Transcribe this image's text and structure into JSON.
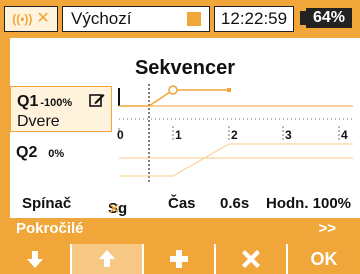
{
  "status": {
    "model": "Výchozí",
    "time": "12:22:59",
    "battery": "64%",
    "accent": "#f0a638"
  },
  "title": "Sekvencer",
  "sequences": [
    {
      "name": "Q1",
      "percent": "-100%",
      "label": "Dvere",
      "selected": true
    },
    {
      "name": "Q2",
      "percent": "0%",
      "label": "",
      "selected": false
    }
  ],
  "graph": {
    "ticks": [
      "0",
      "1",
      "2",
      "3",
      "4"
    ]
  },
  "params": {
    "switch_label": "Spínač",
    "switch_value": "Sg",
    "time_label": "Čas",
    "time_value": "0.6s",
    "value_label": "Hodn. 100%"
  },
  "advanced": {
    "label": "Pokročilé",
    "arrow": ">>"
  },
  "buttons": {
    "ok": "OK"
  }
}
